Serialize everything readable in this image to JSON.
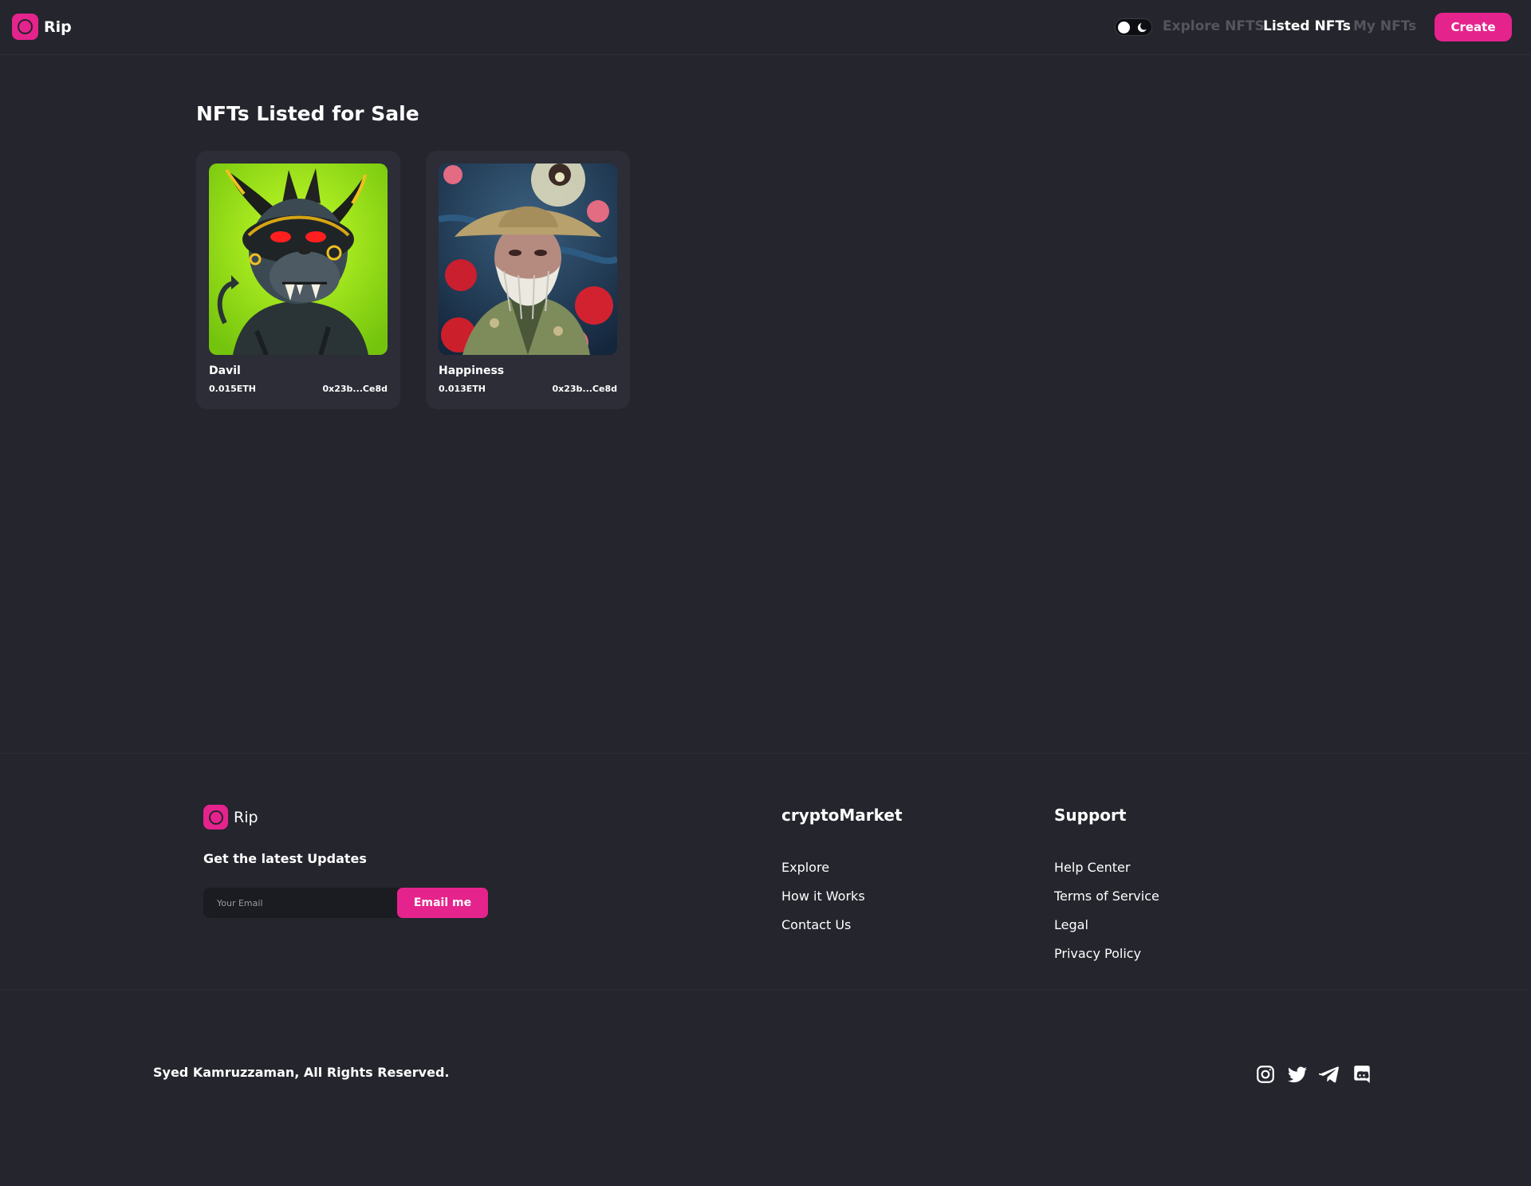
{
  "header": {
    "brand": "Rip",
    "nav": {
      "explore": "Explore NFTS",
      "listed": "Listed NFTs",
      "my_nfts": "My NFTs"
    },
    "create_label": "Create",
    "theme_toggle_icon": "moon-icon"
  },
  "main": {
    "title": "NFTs Listed for Sale",
    "nfts": [
      {
        "name": "Davil",
        "price": "0.015ETH",
        "owner": "0x23b...Ce8d"
      },
      {
        "name": "Happiness",
        "price": "0.013ETH",
        "owner": "0x23b...Ce8d"
      }
    ]
  },
  "footer": {
    "brand": "Rip",
    "updates_heading": "Get the latest Updates",
    "email_placeholder": "Your Email",
    "email_button": "Email me",
    "columns": {
      "market": {
        "title": "cryptoMarket",
        "links": [
          "Explore",
          "How it Works",
          "Contact Us"
        ]
      },
      "support": {
        "title": "Support",
        "links": [
          "Help Center",
          "Terms of Service",
          "Legal",
          "Privacy Policy"
        ]
      }
    },
    "copyright": "Syed Kamruzzaman, All Rights Reserved.",
    "social_icons": [
      "instagram-icon",
      "twitter-icon",
      "telegram-icon",
      "discord-icon"
    ]
  },
  "colors": {
    "background": "#24252d",
    "card": "#2c2d37",
    "accent": "#e5238d",
    "muted_nav": "#54555d"
  }
}
